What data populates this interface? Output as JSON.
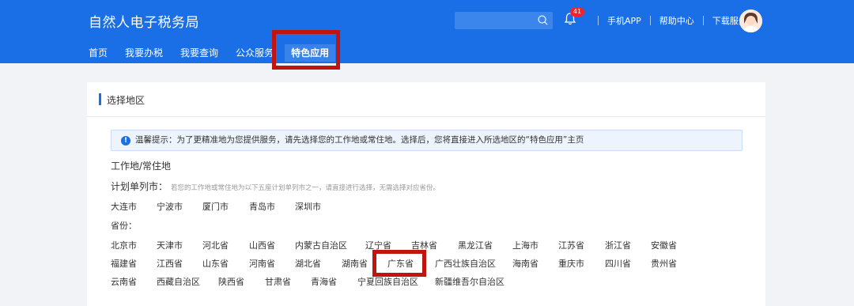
{
  "header": {
    "site_title": "自然人电子税务局",
    "search_placeholder": "",
    "notification_count": "41",
    "links": [
      "手机APP",
      "帮助中心",
      "下载服务"
    ]
  },
  "nav": {
    "items": [
      {
        "label": "首页",
        "active": false
      },
      {
        "label": "我要办税",
        "active": false
      },
      {
        "label": "我要查询",
        "active": false
      },
      {
        "label": "公众服务",
        "active": false
      },
      {
        "label": "特色应用",
        "active": true
      }
    ]
  },
  "card": {
    "title": "选择地区",
    "notice": "温馨提示：为了更精准地为您提供服务，请先选择您的工作地或常住地。选择后，您将直接进入所选地区的“特色应用”主页",
    "work_label": "工作地/常住地",
    "plan_city_label": "计划单列市：",
    "plan_city_hint": "若您的工作地或常住地为以下五座计划单列市之一，请直接进行选择，无需选择对应省份。",
    "plan_cities": [
      "大连市",
      "宁波市",
      "厦门市",
      "青岛市",
      "深圳市"
    ],
    "province_label": "省份：",
    "province_rows": [
      [
        "北京市",
        "天津市",
        "河北省",
        "山西省",
        "内蒙古自治区",
        "辽宁省",
        "吉林省",
        "黑龙江省",
        "上海市",
        "江苏省",
        "浙江省",
        "安徽省"
      ],
      [
        "福建省",
        "江西省",
        "山东省",
        "河南省",
        "湖北省",
        "湖南省",
        "广东省",
        "广西壮族自治区",
        "海南省",
        "重庆市",
        "四川省",
        "贵州省"
      ],
      [
        "云南省",
        "西藏自治区",
        "陕西省",
        "甘肃省",
        "青海省",
        "宁夏回族自治区",
        "新疆维吾尔自治区"
      ]
    ],
    "selected_province": "广东省"
  },
  "colors": {
    "header_bg": "#1a6fe6",
    "highlight_box": "#c0140f",
    "notice_bg": "#edf4fe"
  }
}
